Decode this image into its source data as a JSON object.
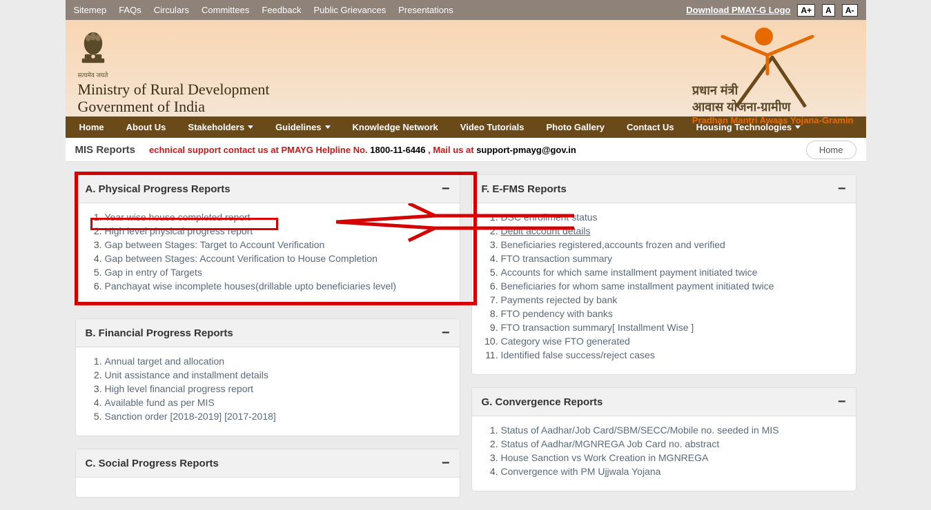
{
  "topbar": {
    "links": [
      "Sitemep",
      "FAQs",
      "Circulars",
      "Committees",
      "Feedback",
      "Public Grievances",
      "Presentations"
    ],
    "download": "Download PMAY-G Logo",
    "font_buttons": [
      "A+",
      "A",
      "A-"
    ]
  },
  "header": {
    "satya": "सत्यमेव जयते",
    "ministry_line1": "Ministry of Rural Development",
    "ministry_line2": "Government of India",
    "scheme_hi1": "प्रधान मंत्री",
    "scheme_hi2": "आवास योजना-ग्रामीण",
    "scheme_en": "Pradhan Mantri Awaas Yojana-Gramin"
  },
  "mainnav": [
    {
      "label": "Home",
      "caret": false
    },
    {
      "label": "About Us",
      "caret": false
    },
    {
      "label": "Stakeholders",
      "caret": true
    },
    {
      "label": "Guidelines",
      "caret": true
    },
    {
      "label": "Knowledge Network",
      "caret": false
    },
    {
      "label": "Video Tutorials",
      "caret": false
    },
    {
      "label": "Photo Gallery",
      "caret": false
    },
    {
      "label": "Contact Us",
      "caret": false
    },
    {
      "label": "Housing Technologies",
      "caret": true
    }
  ],
  "subbar": {
    "title": "MIS Reports",
    "marquee_parts": [
      {
        "cls": "marq-red",
        "text": "echnical support contact us at PMAYG Helpline No. "
      },
      {
        "cls": "marq-black",
        "text": " 1800-11-6446 "
      },
      {
        "cls": "marq-red",
        "text": ", Mail us at "
      },
      {
        "cls": "marq-black",
        "text": " support-pmayg@gov.in "
      }
    ],
    "home_btn": "Home"
  },
  "panels": {
    "A": {
      "title": "A. Physical Progress Reports",
      "items": [
        "Year wise house completed report",
        "High level physical progress report",
        "Gap between Stages: Target to Account Verification",
        "Gap between Stages: Account Verification to House Completion",
        "Gap in entry of Targets",
        "Panchayat wise incomplete houses(drillable upto beneficiaries level)"
      ]
    },
    "B": {
      "title": "B. Financial Progress Reports",
      "items": [
        "Annual target and allocation",
        "Unit assistance and installment details",
        "High level financial progress report",
        "Available fund as per MIS",
        "Sanction order [2018-2019] [2017-2018]"
      ]
    },
    "C": {
      "title": "C. Social Progress Reports",
      "items": []
    },
    "F": {
      "title": "F. E-FMS Reports",
      "items": [
        "DSC enrollment status",
        "Debit account details",
        "Beneficiaries registered,accounts frozen and verified",
        "FTO transaction summary",
        "Accounts for which same installment payment initiated twice",
        "Beneficiaries for whom same installment payment initiated twice",
        "Payments rejected by bank",
        "FTO pendency with banks",
        "FTO transaction summary[ Installment Wise ]",
        "Category wise FTO generated",
        "Identified false success/reject cases"
      ]
    },
    "G": {
      "title": "G. Convergence Reports",
      "items": [
        "Status of Aadhar/Job Card/SBM/SECC/Mobile no. seeded in MIS",
        "Status of Aadhar/MGNREGA Job Card no. abstract",
        "House Sanction vs Work Creation in MGNREGA",
        "Convergence with PM Ujjwala Yojana"
      ]
    }
  },
  "collapse_icon": "−"
}
